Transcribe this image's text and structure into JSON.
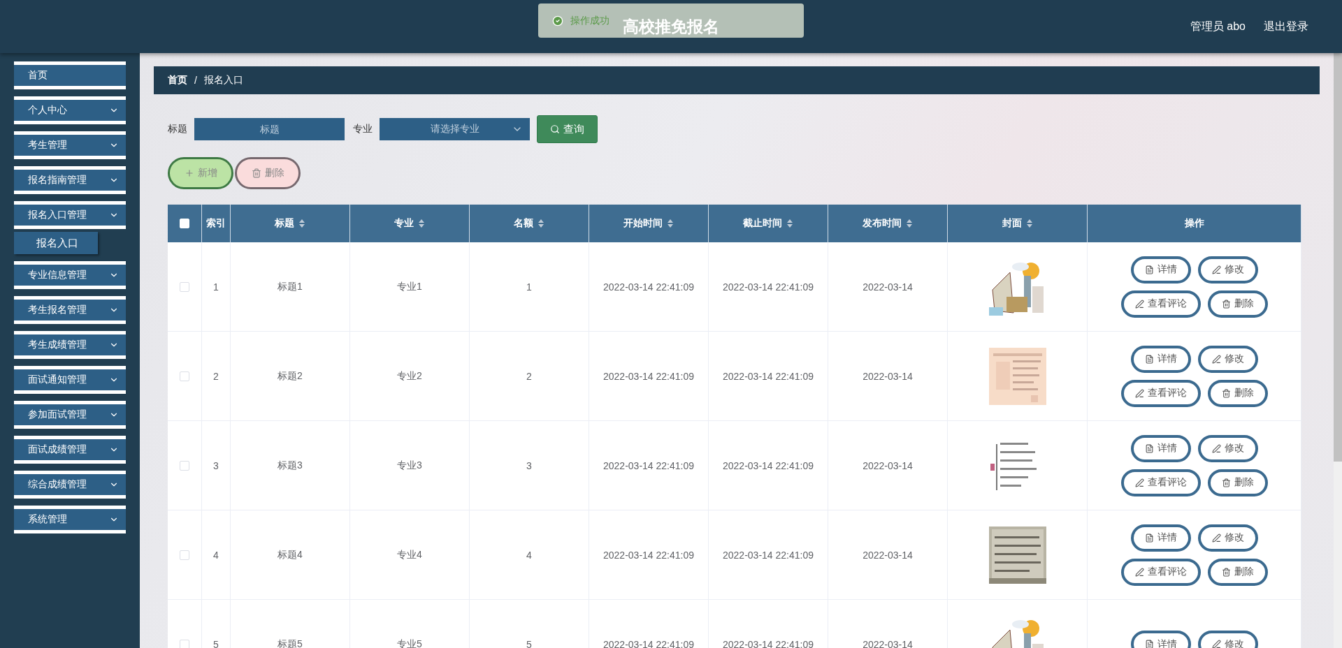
{
  "header": {
    "title": "高校推免报名",
    "user": "管理员 abo",
    "logout": "退出登录"
  },
  "toast": {
    "message": "操作成功"
  },
  "sidebar": {
    "items": [
      {
        "label": "首页",
        "kind": "link"
      },
      {
        "label": "个人中心",
        "kind": "group"
      },
      {
        "label": "考生管理",
        "kind": "group"
      },
      {
        "label": "报名指南管理",
        "kind": "group"
      },
      {
        "label": "报名入口管理",
        "kind": "group",
        "children": [
          {
            "label": "报名入口"
          }
        ]
      },
      {
        "label": "专业信息管理",
        "kind": "group"
      },
      {
        "label": "考生报名管理",
        "kind": "group"
      },
      {
        "label": "考生成绩管理",
        "kind": "group"
      },
      {
        "label": "面试通知管理",
        "kind": "group"
      },
      {
        "label": "参加面试管理",
        "kind": "group"
      },
      {
        "label": "面试成绩管理",
        "kind": "group"
      },
      {
        "label": "综合成绩管理",
        "kind": "group"
      },
      {
        "label": "系统管理",
        "kind": "group"
      }
    ]
  },
  "breadcrumb": [
    "首页",
    "/",
    "报名入口"
  ],
  "search": {
    "title_label": "标题",
    "title_placeholder": "标题",
    "major_label": "专业",
    "major_placeholder": "请选择专业",
    "query_button": "查询"
  },
  "toolbar": {
    "add_button": "新增",
    "delete_button": "删除"
  },
  "table": {
    "select_all_checked": false,
    "columns": [
      {
        "label": "索引",
        "sortable": false
      },
      {
        "label": "标题",
        "sortable": true
      },
      {
        "label": "专业",
        "sortable": true
      },
      {
        "label": "名额",
        "sortable": true
      },
      {
        "label": "开始时间",
        "sortable": true
      },
      {
        "label": "截止时间",
        "sortable": true
      },
      {
        "label": "发布时间",
        "sortable": true
      },
      {
        "label": "封面",
        "sortable": true
      },
      {
        "label": "操作",
        "sortable": false
      }
    ],
    "rows": [
      {
        "checked": false,
        "cells": [
          "1",
          "标题1",
          "专业1",
          "1",
          "2022-03-14 22:41:09",
          "2022-03-14 22:41:09",
          "2022-03-14"
        ],
        "cover": {
          "kind": "picture"
        },
        "actions": [
          {
            "label": "详情",
            "kind": "detail"
          },
          {
            "label": "修改",
            "kind": "edit"
          },
          {
            "label": "查看评论",
            "kind": "comment"
          },
          {
            "label": "删除",
            "kind": "delete"
          }
        ]
      },
      {
        "checked": false,
        "cells": [
          "2",
          "标题2",
          "专业2",
          "2",
          "2022-03-14 22:41:09",
          "2022-03-14 22:41:09",
          "2022-03-14"
        ],
        "cover": {
          "kind": "picture"
        },
        "actions": [
          {
            "label": "详情",
            "kind": "detail"
          },
          {
            "label": "修改",
            "kind": "edit"
          },
          {
            "label": "查看评论",
            "kind": "comment"
          },
          {
            "label": "删除",
            "kind": "delete"
          }
        ]
      },
      {
        "checked": false,
        "cells": [
          "3",
          "标题3",
          "专业3",
          "3",
          "2022-03-14 22:41:09",
          "2022-03-14 22:41:09",
          "2022-03-14"
        ],
        "cover": {
          "kind": "picture"
        },
        "actions": [
          {
            "label": "详情",
            "kind": "detail"
          },
          {
            "label": "修改",
            "kind": "edit"
          },
          {
            "label": "查看评论",
            "kind": "comment"
          },
          {
            "label": "删除",
            "kind": "delete"
          }
        ]
      },
      {
        "checked": false,
        "cells": [
          "4",
          "标题4",
          "专业4",
          "4",
          "2022-03-14 22:41:09",
          "2022-03-14 22:41:09",
          "2022-03-14"
        ],
        "cover": {
          "kind": "picture"
        },
        "actions": [
          {
            "label": "详情",
            "kind": "detail"
          },
          {
            "label": "修改",
            "kind": "edit"
          },
          {
            "label": "查看评论",
            "kind": "comment"
          },
          {
            "label": "删除",
            "kind": "delete"
          }
        ]
      },
      {
        "checked": false,
        "cells": [
          "5",
          "标题5",
          "专业5",
          "5",
          "2022-03-14 22:41:09",
          "2022-03-14 22:41:09",
          "2022-03-14"
        ],
        "cover": {
          "kind": "picture"
        },
        "actions": [
          {
            "label": "详情",
            "kind": "detail"
          },
          {
            "label": "修改",
            "kind": "edit"
          }
        ]
      }
    ]
  }
}
